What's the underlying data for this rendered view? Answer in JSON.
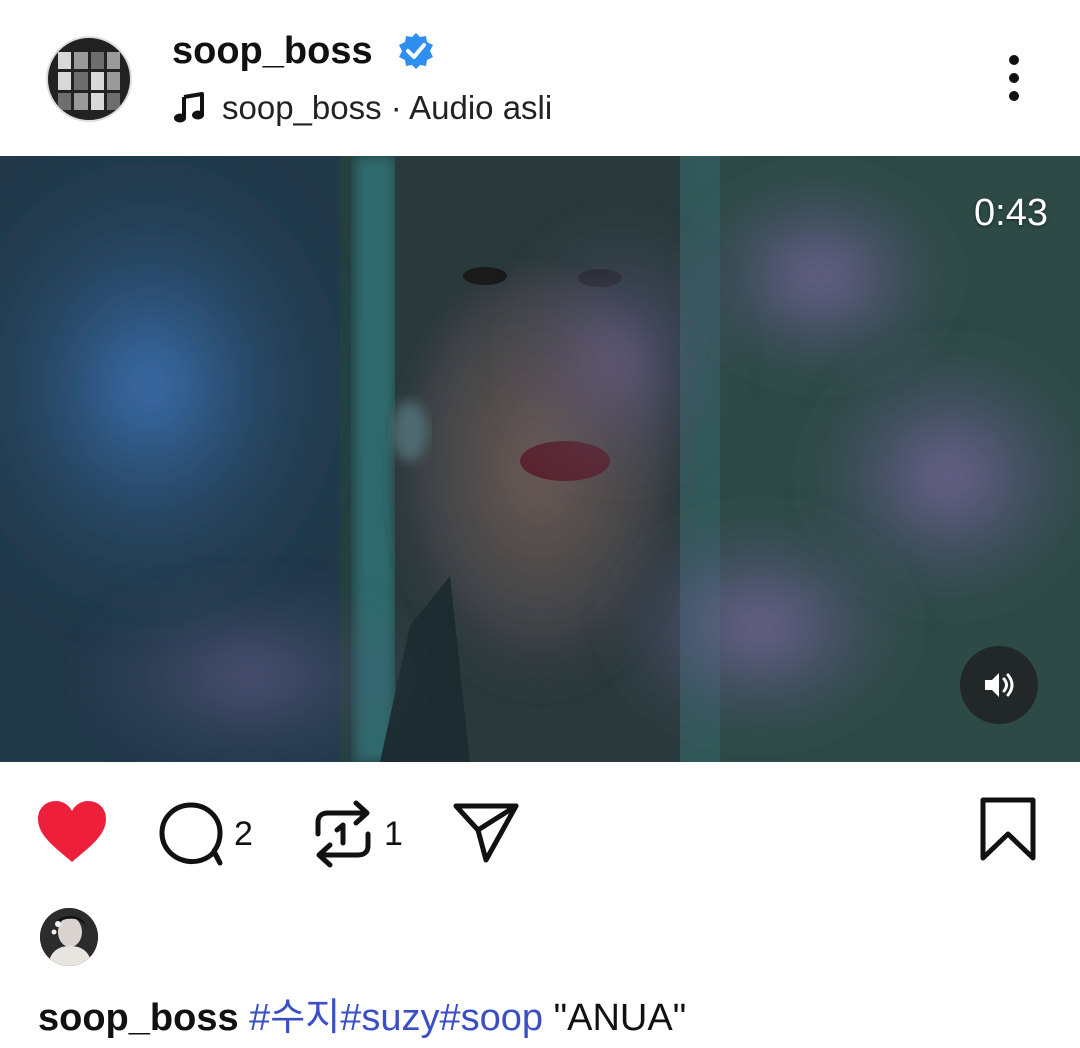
{
  "post": {
    "username": "soop_boss",
    "audio_label": "soop_boss · Audio asli",
    "icons": {
      "avatar": "profile-avatar",
      "verified": "verified-badge-icon",
      "music": "music-note-icon",
      "more": "more-vertical-icon"
    }
  },
  "video": {
    "duration": "0:43",
    "volume_icon": "volume-on-icon"
  },
  "actions": {
    "like_icon": "heart-filled-icon",
    "like_color": "#ed1f3b",
    "comment_count": "2",
    "repost_count": "1",
    "share_icon": "send-icon",
    "save_icon": "bookmark-icon"
  },
  "caption": {
    "username": "soop_boss",
    "hashtags": [
      "#수지",
      "#suzy",
      "#soop"
    ],
    "text": "\"ANUA\"",
    "hashtag_color": "#3a4fc5"
  }
}
